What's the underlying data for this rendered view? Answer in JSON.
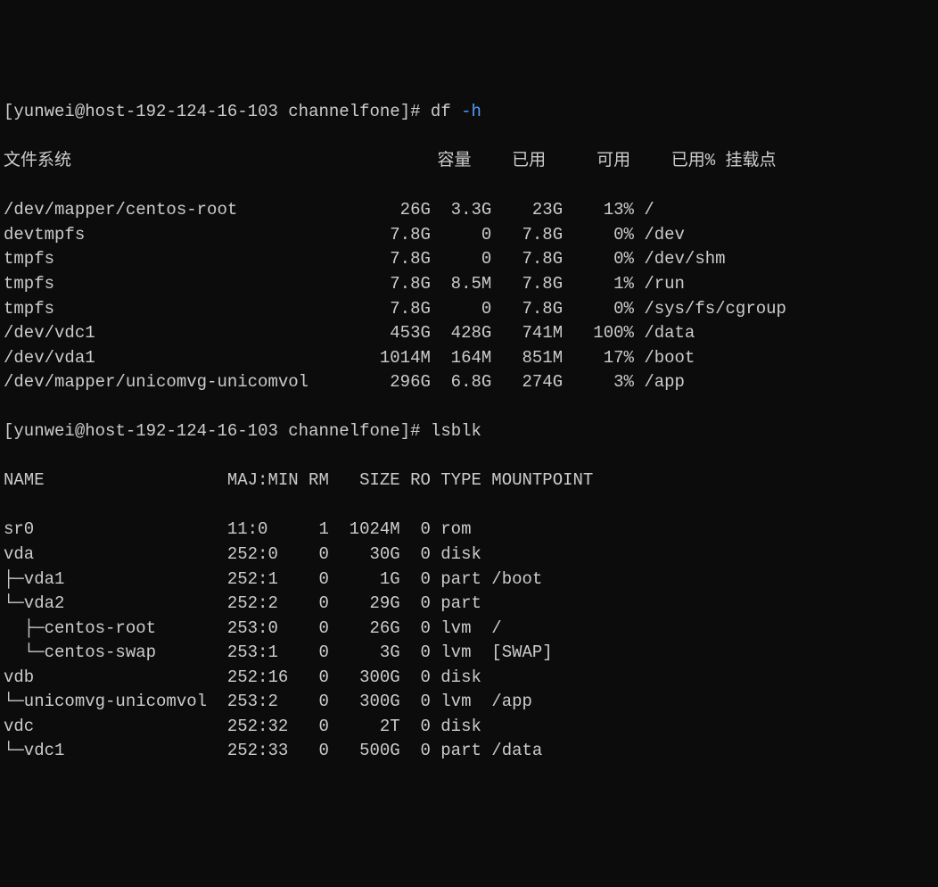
{
  "prompt1": {
    "user": "yunwei",
    "host": "host-192-124-16-103",
    "dir": "channelfone",
    "symbol": "#",
    "cmd": "df",
    "flag": "-h"
  },
  "df_header": {
    "fs": "文件系统",
    "size": "容量",
    "used": "已用",
    "avail": "可用",
    "usepct": "已用%",
    "mount": "挂载点"
  },
  "df_rows": [
    {
      "fs": "/dev/mapper/centos-root",
      "size": "26G",
      "used": "3.3G",
      "avail": "23G",
      "usepct": "13%",
      "mount": "/"
    },
    {
      "fs": "devtmpfs",
      "size": "7.8G",
      "used": "0",
      "avail": "7.8G",
      "usepct": "0%",
      "mount": "/dev"
    },
    {
      "fs": "tmpfs",
      "size": "7.8G",
      "used": "0",
      "avail": "7.8G",
      "usepct": "0%",
      "mount": "/dev/shm"
    },
    {
      "fs": "tmpfs",
      "size": "7.8G",
      "used": "8.5M",
      "avail": "7.8G",
      "usepct": "1%",
      "mount": "/run"
    },
    {
      "fs": "tmpfs",
      "size": "7.8G",
      "used": "0",
      "avail": "7.8G",
      "usepct": "0%",
      "mount": "/sys/fs/cgroup"
    },
    {
      "fs": "/dev/vdc1",
      "size": "453G",
      "used": "428G",
      "avail": "741M",
      "usepct": "100%",
      "mount": "/data"
    },
    {
      "fs": "/dev/vda1",
      "size": "1014M",
      "used": "164M",
      "avail": "851M",
      "usepct": "17%",
      "mount": "/boot"
    },
    {
      "fs": "/dev/mapper/unicomvg-unicomvol",
      "size": "296G",
      "used": "6.8G",
      "avail": "274G",
      "usepct": "3%",
      "mount": "/app"
    }
  ],
  "prompt2": {
    "user": "yunwei",
    "host": "host-192-124-16-103",
    "dir": "channelfone",
    "symbol": "#",
    "cmd": "lsblk"
  },
  "lsblk_header": {
    "name": "NAME",
    "majmin": "MAJ:MIN",
    "rm": "RM",
    "size": "SIZE",
    "ro": "RO",
    "type": "TYPE",
    "mount": "MOUNTPOINT"
  },
  "lsblk_rows": [
    {
      "prefix": "",
      "name": "sr0",
      "majmin": "11:0",
      "rm": "1",
      "size": "1024M",
      "ro": "0",
      "type": "rom",
      "mount": ""
    },
    {
      "prefix": "",
      "name": "vda",
      "majmin": "252:0",
      "rm": "0",
      "size": "30G",
      "ro": "0",
      "type": "disk",
      "mount": ""
    },
    {
      "prefix": "├─",
      "name": "vda1",
      "majmin": "252:1",
      "rm": "0",
      "size": "1G",
      "ro": "0",
      "type": "part",
      "mount": "/boot"
    },
    {
      "prefix": "└─",
      "name": "vda2",
      "majmin": "252:2",
      "rm": "0",
      "size": "29G",
      "ro": "0",
      "type": "part",
      "mount": ""
    },
    {
      "prefix": "  ├─",
      "name": "centos-root",
      "majmin": "253:0",
      "rm": "0",
      "size": "26G",
      "ro": "0",
      "type": "lvm",
      "mount": "/"
    },
    {
      "prefix": "  └─",
      "name": "centos-swap",
      "majmin": "253:1",
      "rm": "0",
      "size": "3G",
      "ro": "0",
      "type": "lvm",
      "mount": "[SWAP]"
    },
    {
      "prefix": "",
      "name": "vdb",
      "majmin": "252:16",
      "rm": "0",
      "size": "300G",
      "ro": "0",
      "type": "disk",
      "mount": ""
    },
    {
      "prefix": "└─",
      "name": "unicomvg-unicomvol",
      "majmin": "253:2",
      "rm": "0",
      "size": "300G",
      "ro": "0",
      "type": "lvm",
      "mount": "/app"
    },
    {
      "prefix": "",
      "name": "vdc",
      "majmin": "252:32",
      "rm": "0",
      "size": "2T",
      "ro": "0",
      "type": "disk",
      "mount": ""
    },
    {
      "prefix": "└─",
      "name": "vdc1",
      "majmin": "252:33",
      "rm": "0",
      "size": "500G",
      "ro": "0",
      "type": "part",
      "mount": "/data"
    }
  ]
}
